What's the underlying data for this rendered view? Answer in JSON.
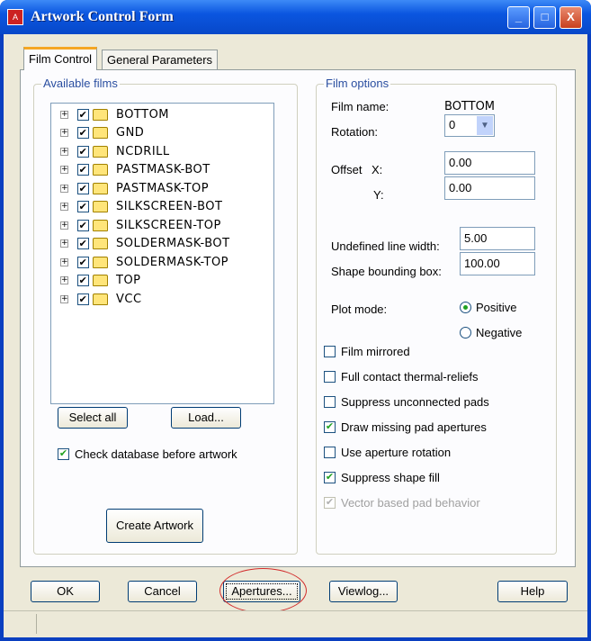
{
  "window": {
    "title": "Artwork Control Form",
    "controls": {
      "minimize": "_",
      "maximize": "□",
      "close": "X"
    }
  },
  "tabs": [
    {
      "label": "Film Control",
      "active": true
    },
    {
      "label": "General Parameters",
      "active": false
    }
  ],
  "available_films": {
    "legend": "Available films",
    "items": [
      {
        "label": "BOTTOM",
        "checked": true
      },
      {
        "label": "GND",
        "checked": true
      },
      {
        "label": "NCDRILL",
        "checked": true
      },
      {
        "label": "PASTMASK-BOT",
        "checked": true
      },
      {
        "label": "PASTMASK-TOP",
        "checked": true
      },
      {
        "label": "SILKSCREEN-BOT",
        "checked": true
      },
      {
        "label": "SILKSCREEN-TOP",
        "checked": true
      },
      {
        "label": "SOLDERMASK-BOT",
        "checked": true
      },
      {
        "label": "SOLDERMASK-TOP",
        "checked": true
      },
      {
        "label": "TOP",
        "checked": true
      },
      {
        "label": "VCC",
        "checked": true
      }
    ],
    "select_all": "Select all",
    "load": "Load...",
    "check_db": "Check database before artwork",
    "check_db_checked": true,
    "create": "Create Artwork"
  },
  "film_options": {
    "legend": "Film options",
    "film_name_label": "Film name:",
    "film_name": "BOTTOM",
    "rotation_label": "Rotation:",
    "rotation": "0",
    "offset_label": "Offset",
    "x_label": "X:",
    "x": "0.00",
    "y_label": "Y:",
    "y": "0.00",
    "ulw_label": "Undefined line width:",
    "ulw": "5.00",
    "sbb_label": "Shape bounding box:",
    "sbb": "100.00",
    "plot_mode_label": "Plot mode:",
    "positive": "Positive",
    "negative": "Negative",
    "plot_mode": "Positive",
    "checks": [
      {
        "label": "Film mirrored",
        "checked": false
      },
      {
        "label": "Full contact thermal-reliefs",
        "checked": false
      },
      {
        "label": "Suppress unconnected pads",
        "checked": false
      },
      {
        "label": "Draw missing pad apertures",
        "checked": true
      },
      {
        "label": "Use aperture rotation",
        "checked": false
      },
      {
        "label": "Suppress shape fill",
        "checked": true
      },
      {
        "label": "Vector based pad behavior",
        "checked": true,
        "disabled": true
      }
    ]
  },
  "buttons": {
    "ok": "OK",
    "cancel": "Cancel",
    "apertures": "Apertures...",
    "viewlog": "Viewlog...",
    "help": "Help"
  },
  "colors": {
    "title_bar": "#0b56e0",
    "highlight_ellipse": "#d22b2b"
  }
}
